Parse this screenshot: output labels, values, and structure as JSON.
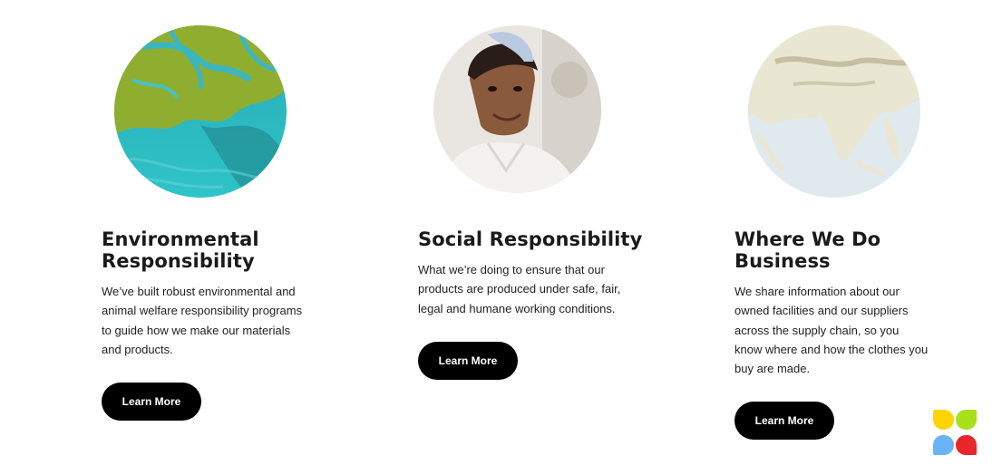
{
  "cards": [
    {
      "title": "Environmental Responsibility",
      "title_line1": "Environmental",
      "title_line2": "Responsibility",
      "description": "We’ve built robust environmental and animal welfare responsibility programs to guide how we make our materials and products.",
      "button_label": "Learn More",
      "image": "aerial-coastline-image"
    },
    {
      "title": "Social Responsibility",
      "description": "What we’re doing to ensure that our products are produced under safe, fair, legal and humane working conditions.",
      "button_label": "Learn More",
      "image": "factory-worker-portrait-image"
    },
    {
      "title": "Where We Do Business",
      "title_line1": "Where We Do",
      "title_line2": "Business",
      "description": "We share information about our owned facilities and our suppliers across the supply chain, so you know where and how the clothes you buy are made.",
      "button_label": "Learn More",
      "image": "world-map-image"
    }
  ],
  "colors": {
    "button_bg": "#000000",
    "button_text": "#ffffff",
    "logo_yellow": "#ffd400",
    "logo_green": "#a8e01c",
    "logo_blue": "#6ab4f5",
    "logo_red": "#e8262b"
  },
  "widget_icon": "four-petal-logo-icon"
}
